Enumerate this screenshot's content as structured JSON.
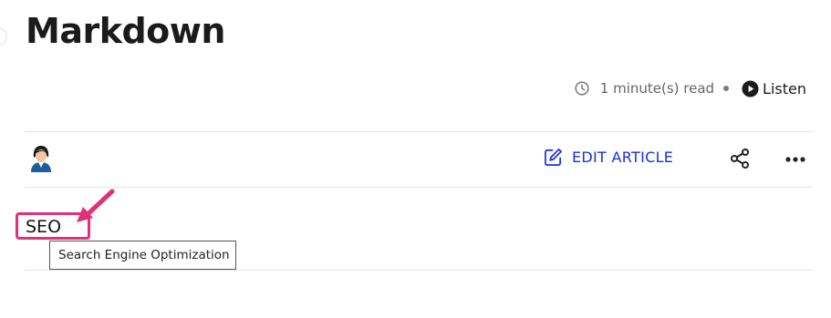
{
  "article": {
    "title": "Markdown",
    "read_time": "1 minute(s) read",
    "listen_label": "Listen"
  },
  "toolbar": {
    "edit_label": "EDIT ARTICLE"
  },
  "content": {
    "abbr_text": "SEO",
    "tooltip_text": "Search Engine Optimization"
  },
  "icons": {
    "clock": "clock-icon",
    "play": "play-circle-icon",
    "avatar": "avatar-icon",
    "edit": "edit-pencil-icon",
    "share": "share-icon",
    "more": "more-horizontal-icon",
    "arrow": "annotation-arrow"
  },
  "colors": {
    "accent": "#1a2fe0",
    "highlight": "#e0307a",
    "text": "#1b1b1b",
    "muted": "#666666"
  }
}
